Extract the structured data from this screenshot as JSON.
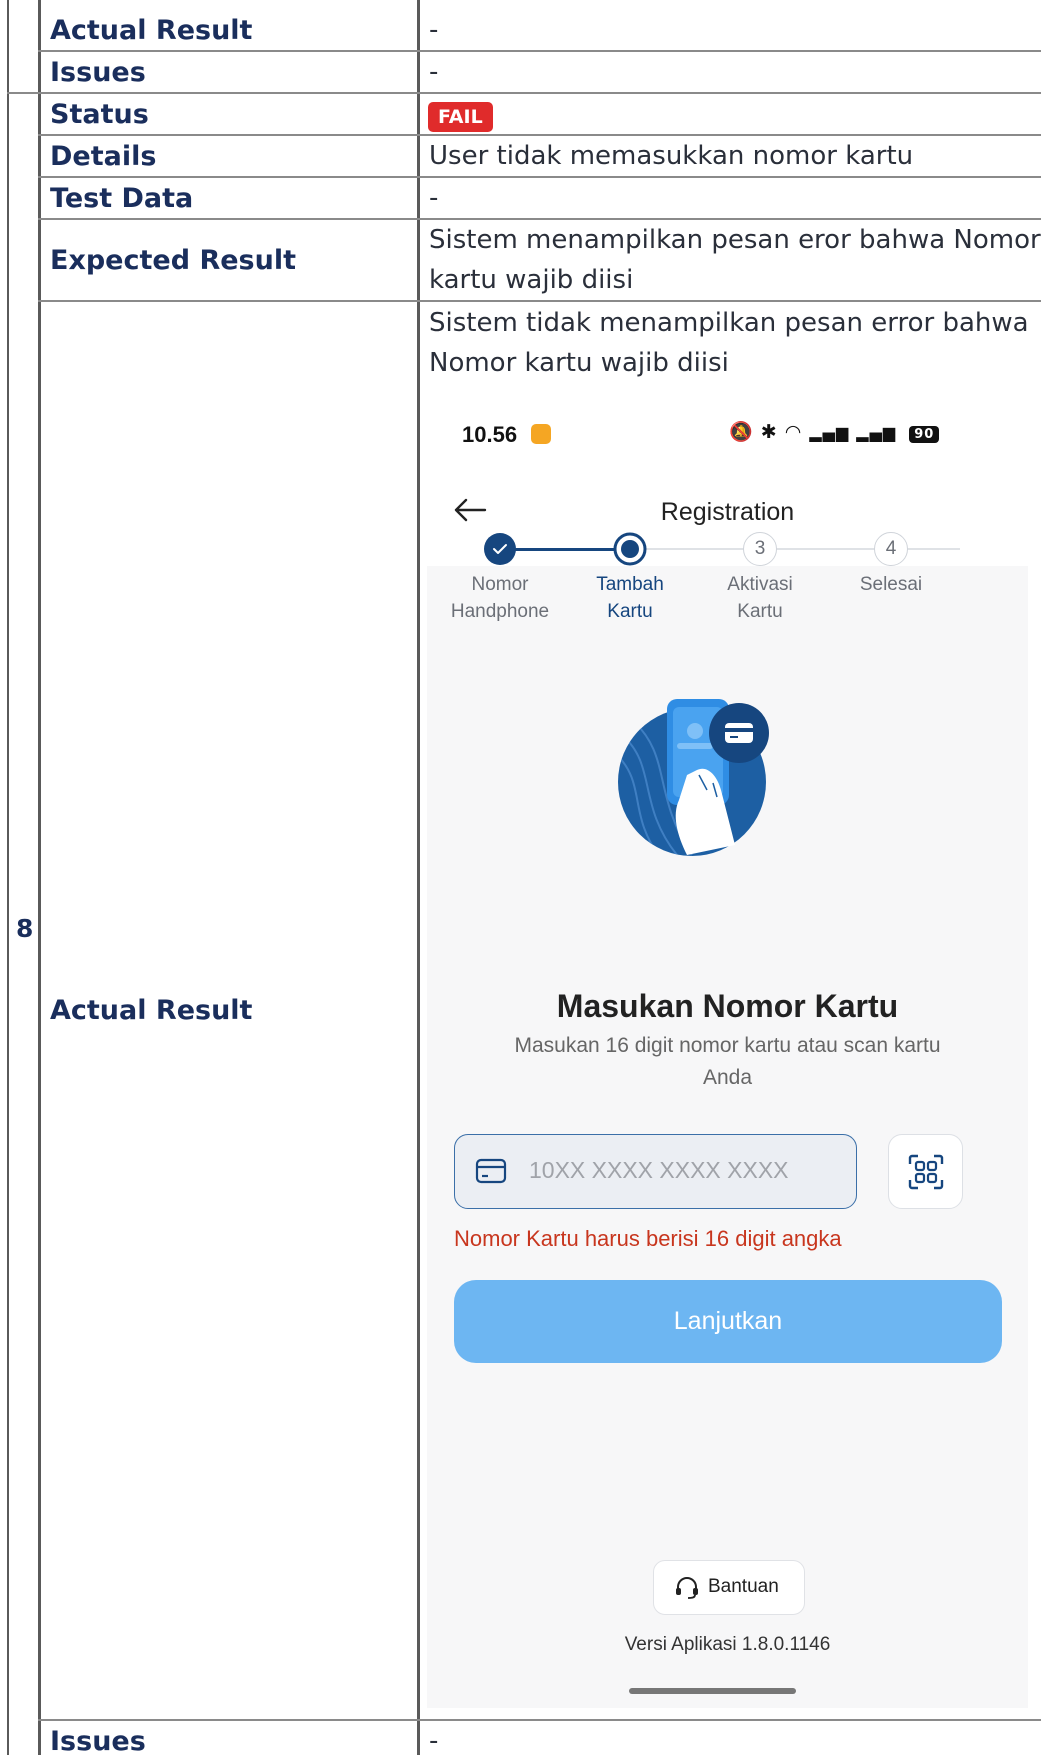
{
  "rows_top": [
    {
      "label": "Actual Result",
      "value": "-"
    },
    {
      "label": "Issues",
      "value": "-"
    }
  ],
  "case": {
    "number": "8",
    "status_label": "Status",
    "status_badge": "FAIL",
    "details_label": "Details",
    "details_value": "User tidak memasukkan nomor kartu",
    "test_data_label": "Test Data",
    "test_data_value": "-",
    "expected_label": "Expected Result",
    "expected_value_line1": "Sistem menampilkan pesan eror bahwa Nomor",
    "expected_value_line2": "kartu wajib diisi",
    "actual_label": "Actual Result",
    "actual_value_line1": "Sistem tidak menampilkan pesan error bahwa",
    "actual_value_line2": "Nomor kartu wajib diisi",
    "issues_label": "Issues",
    "issues_value": "-"
  },
  "app": {
    "time": "10.56",
    "battery": "90",
    "title": "Registration",
    "steps": [
      {
        "num": "",
        "line1": "Nomor",
        "line2": "Handphone",
        "state": "done"
      },
      {
        "num": "",
        "line1": "Tambah",
        "line2": "Kartu",
        "state": "active"
      },
      {
        "num": "3",
        "line1": "Aktivasi",
        "line2": "Kartu",
        "state": "pending"
      },
      {
        "num": "4",
        "line1": "Selesai",
        "line2": "",
        "state": "pending"
      }
    ],
    "heading": "Masukan Nomor Kartu",
    "subtext": "Masukan 16 digit nomor kartu atau scan kartu Anda",
    "card_placeholder": "10XX XXXX XXXX XXXX",
    "error": "Nomor Kartu harus berisi 16 digit angka",
    "continue_button": "Lanjutkan",
    "help_button": "Bantuan",
    "version_label": "Versi Aplikasi  1.8.0.1146",
    "colors": {
      "primary": "#16467f",
      "button": "#6db6f2",
      "error": "#c8361e"
    },
    "icons": [
      "back-arrow-icon",
      "card-icon",
      "scan-qr-icon",
      "headset-icon"
    ]
  }
}
